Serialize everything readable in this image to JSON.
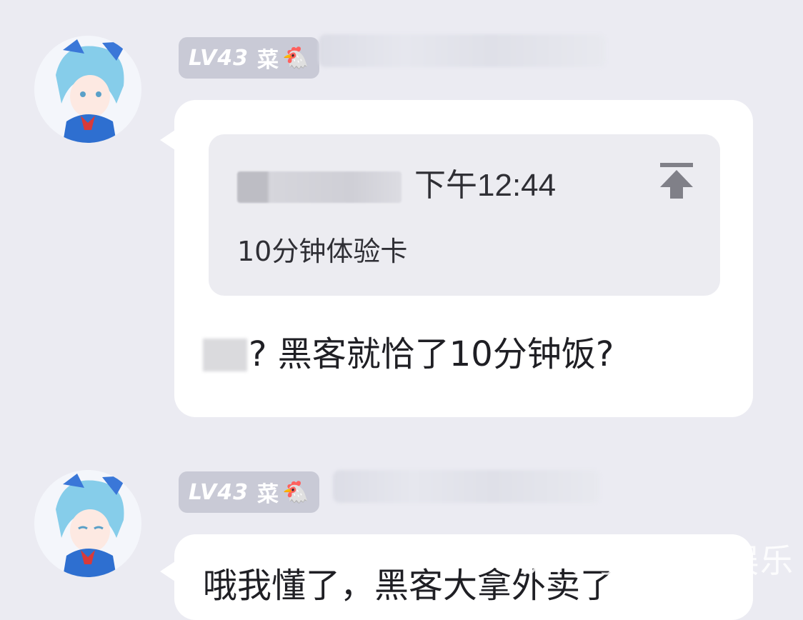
{
  "messages": [
    {
      "badge": {
        "level": "LV43",
        "title": "菜",
        "icon": "chicken-icon"
      },
      "quote": {
        "time": "下午12:44",
        "text": "10分钟体验卡"
      },
      "text_part": "? 黑客就恰了10分钟饭?"
    },
    {
      "badge": {
        "level": "LV43",
        "title": "菜",
        "icon": "chicken-icon"
      },
      "text_part": "哦我懂了，黑客大拿外卖了"
    }
  ],
  "watermark": "快传号 / 筷清娱乐",
  "colors": {
    "background": "#ebebf2",
    "bubble": "#ffffff",
    "badge": "#c9cad6",
    "quote": "#ececf1"
  }
}
